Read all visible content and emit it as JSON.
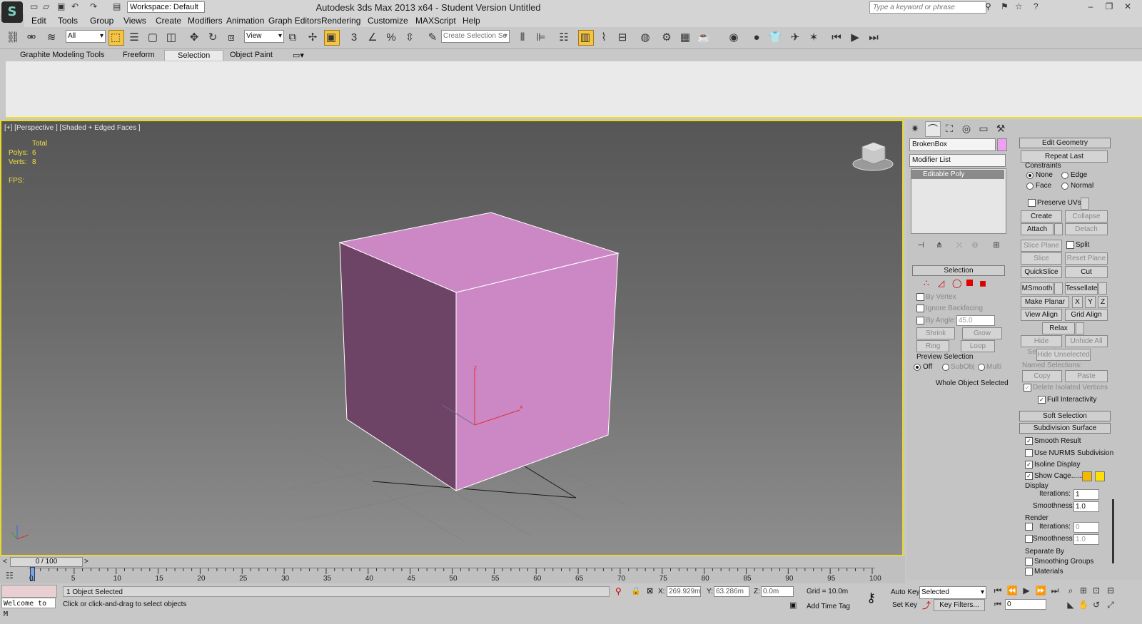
{
  "app": {
    "title": "Autodesk 3ds Max  2013 x64  - Student Version    Untitled",
    "workspace": "Workspace: Default",
    "search_placeholder": "Type a keyword or phrase",
    "logo_glyph": "S"
  },
  "menu": [
    "Edit",
    "Tools",
    "Group",
    "Views",
    "Create",
    "Modifiers",
    "Animation",
    "Graph Editors",
    "Rendering",
    "Customize",
    "MAXScript",
    "Help"
  ],
  "toolbar": {
    "filter": "All",
    "ref_coord": "View",
    "named_selection": "Create Selection Se"
  },
  "ribbon_tabs": [
    "Graphite Modeling Tools",
    "Freeform",
    "Selection",
    "Object Paint"
  ],
  "viewport": {
    "label": "[+] [Perspective ] [Shaded + Edged Faces ]",
    "stats_header": "Total",
    "polys_label": "Polys:",
    "polys": "6",
    "verts_label": "Verts:",
    "verts": "8",
    "fps_label": "FPS:",
    "box_color": "#cc88c4",
    "axis": {
      "z": "z",
      "x": "x",
      "y": "y"
    }
  },
  "command_panel": {
    "object_name": "BrokenBox",
    "object_color": "#f0a0f0",
    "modifier_list": "Modifier List",
    "stack_item": "Editable Poly",
    "selection": {
      "title": "Selection",
      "by_vertex": "By Vertex",
      "ignore_backfacing": "Ignore Backfacing",
      "by_angle": "By Angle:",
      "angle": "45.0",
      "shrink": "Shrink",
      "grow": "Grow",
      "ring": "Ring",
      "loop": "Loop",
      "preview_title": "Preview Selection",
      "off": "Off",
      "subobj": "SubObj",
      "multi": "Multi",
      "status": "Whole Object Selected"
    },
    "edit_geometry": {
      "title": "Edit Geometry",
      "repeat_last": "Repeat Last",
      "constraints": "Constraints",
      "none": "None",
      "edge": "Edge",
      "face": "Face",
      "normal": "Normal",
      "preserve_uvs": "Preserve UVs",
      "create": "Create",
      "collapse": "Collapse",
      "attach": "Attach",
      "detach": "Detach",
      "slice_plane": "Slice Plane",
      "split": "Split",
      "slice": "Slice",
      "reset_plane": "Reset Plane",
      "quickslice": "QuickSlice",
      "cut": "Cut",
      "msmooth": "MSmooth",
      "tessellate": "Tessellate",
      "make_planar": "Make Planar",
      "x": "X",
      "y": "Y",
      "z": "Z",
      "view_align": "View Align",
      "grid_align": "Grid Align",
      "relax": "Relax",
      "hide_selected": "Hide Selected",
      "unhide_all": "Unhide All",
      "hide_unselected": "Hide Unselected",
      "named_selections": "Named Selections:",
      "copy": "Copy",
      "paste": "Paste",
      "delete_isolated": "Delete Isolated Vertices",
      "full_interactivity": "Full Interactivity"
    },
    "soft_selection": "Soft Selection",
    "subdivision": {
      "title": "Subdivision Surface",
      "smooth_result": "Smooth Result",
      "use_nurms": "Use NURMS Subdivision",
      "isoline": "Isoline Display",
      "show_cage": "Show Cage......",
      "cage_color1": "#f5b800",
      "cage_color2": "#ffe000",
      "display": "Display",
      "iterations_label": "Iterations:",
      "iterations": "1",
      "smoothness_label": "Smoothness:",
      "smoothness": "1.0",
      "render": "Render",
      "render_iterations": "0",
      "render_smoothness": "1.0",
      "separate_by": "Separate By",
      "smoothing_groups": "Smoothing Groups",
      "materials": "Materials"
    }
  },
  "timeline": {
    "frame": "0 / 100",
    "ticks": [
      "0",
      "5",
      "10",
      "15",
      "20",
      "25",
      "30",
      "35",
      "40",
      "45",
      "50",
      "55",
      "60",
      "65",
      "70",
      "75",
      "80",
      "85",
      "90",
      "95",
      "100"
    ]
  },
  "status": {
    "welcome": "Welcome to M",
    "selected": "1 Object Selected",
    "prompt": "Click or click-and-drag to select objects",
    "x_label": "X:",
    "x": "269.929m",
    "y_label": "Y:",
    "y": "63.286m",
    "z_label": "Z:",
    "z": "0.0m",
    "grid": "Grid = 10.0m",
    "add_time_tag": "Add Time Tag",
    "auto_key": "Auto Key",
    "set_key": "Set Key",
    "key_mode": "Selected",
    "key_filters": "Key Filters...",
    "current_frame": "0"
  }
}
